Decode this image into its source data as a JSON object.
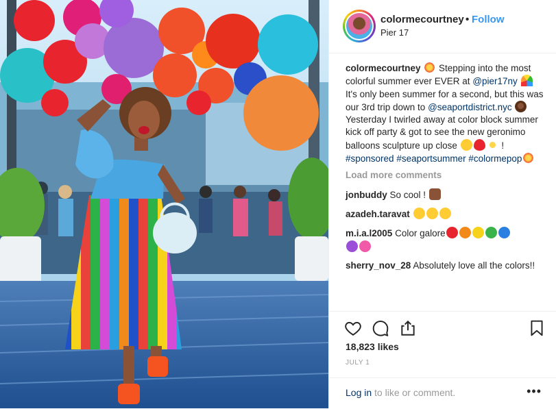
{
  "post": {
    "username": "colormecourtney",
    "dot": "•",
    "follow_label": "Follow",
    "location": "Pier 17"
  },
  "caption": {
    "username": "colormecourtney",
    "t1": " Stepping into the most colorful summer ever EVER at ",
    "mention1": "@pier17ny",
    "t2": " It's only been summer for a second, but this was our 3rd trip down to ",
    "mention2": "@seaportdistrict.nyc",
    "t3": " Yesterday I twirled away at color block summer kick off party & got to see the new geronimo balloons sculpture up close ",
    "t4": " ! ",
    "tag1": "#sponsored",
    "tag2": "#seaportsummer",
    "tag3": "#colormepop"
  },
  "load_more": "Load more comments",
  "comments": [
    {
      "user": "jonbuddy",
      "text": " So cool !"
    },
    {
      "user": "azadeh.taravat",
      "text": " "
    },
    {
      "user": "m.i.a.l2005",
      "text": " Color galore"
    },
    {
      "user": "sherry_nov_28",
      "text": " Absolutely love all the colors!!"
    }
  ],
  "icons": {
    "like": "heart-icon",
    "comment": "comment-icon",
    "share": "share-icon",
    "save": "bookmark-icon",
    "more": "more-options-icon"
  },
  "likes": "18,823 likes",
  "date": "JULY 1",
  "footer": {
    "login_link": "Log in",
    "login_text": " to like or comment.",
    "more": "•••"
  },
  "colors": {
    "link": "#003569",
    "follow": "#3897f0",
    "muted": "#999999"
  }
}
